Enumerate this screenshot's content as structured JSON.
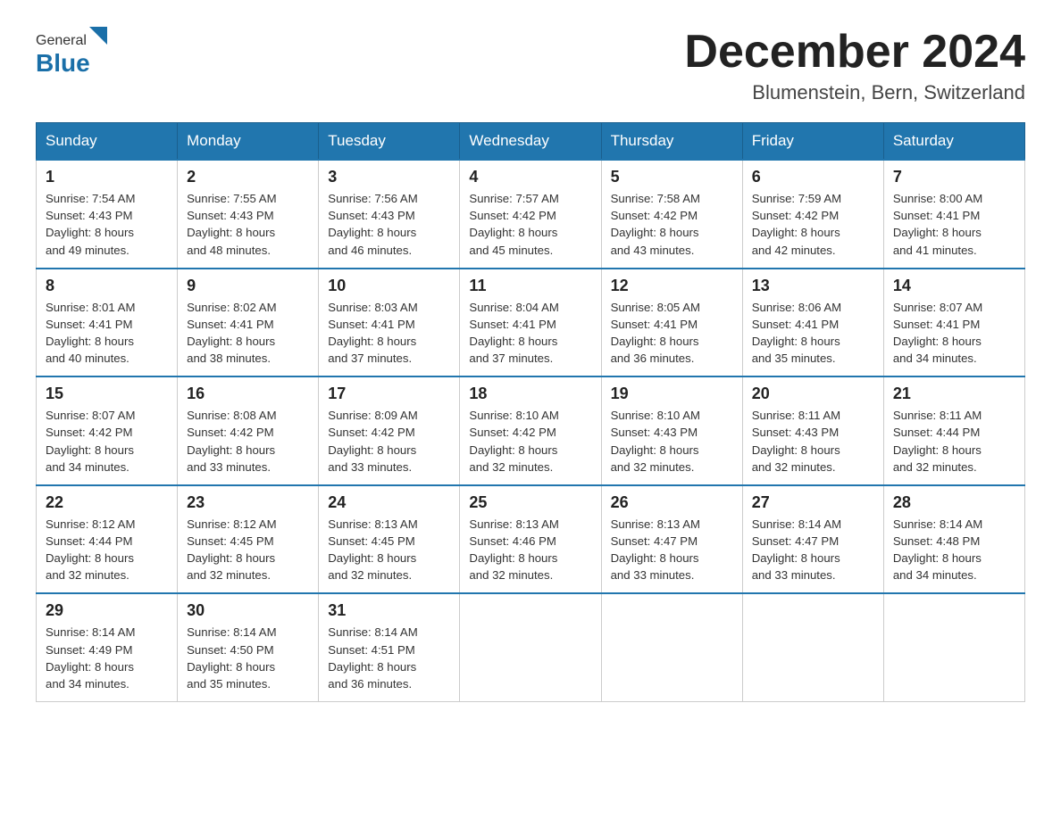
{
  "header": {
    "logo_general": "General",
    "logo_blue": "Blue",
    "month_title": "December 2024",
    "location": "Blumenstein, Bern, Switzerland"
  },
  "days_of_week": [
    "Sunday",
    "Monday",
    "Tuesday",
    "Wednesday",
    "Thursday",
    "Friday",
    "Saturday"
  ],
  "weeks": [
    [
      {
        "day": "1",
        "sunrise": "7:54 AM",
        "sunset": "4:43 PM",
        "daylight": "8 hours and 49 minutes."
      },
      {
        "day": "2",
        "sunrise": "7:55 AM",
        "sunset": "4:43 PM",
        "daylight": "8 hours and 48 minutes."
      },
      {
        "day": "3",
        "sunrise": "7:56 AM",
        "sunset": "4:43 PM",
        "daylight": "8 hours and 46 minutes."
      },
      {
        "day": "4",
        "sunrise": "7:57 AM",
        "sunset": "4:42 PM",
        "daylight": "8 hours and 45 minutes."
      },
      {
        "day": "5",
        "sunrise": "7:58 AM",
        "sunset": "4:42 PM",
        "daylight": "8 hours and 43 minutes."
      },
      {
        "day": "6",
        "sunrise": "7:59 AM",
        "sunset": "4:42 PM",
        "daylight": "8 hours and 42 minutes."
      },
      {
        "day": "7",
        "sunrise": "8:00 AM",
        "sunset": "4:41 PM",
        "daylight": "8 hours and 41 minutes."
      }
    ],
    [
      {
        "day": "8",
        "sunrise": "8:01 AM",
        "sunset": "4:41 PM",
        "daylight": "8 hours and 40 minutes."
      },
      {
        "day": "9",
        "sunrise": "8:02 AM",
        "sunset": "4:41 PM",
        "daylight": "8 hours and 38 minutes."
      },
      {
        "day": "10",
        "sunrise": "8:03 AM",
        "sunset": "4:41 PM",
        "daylight": "8 hours and 37 minutes."
      },
      {
        "day": "11",
        "sunrise": "8:04 AM",
        "sunset": "4:41 PM",
        "daylight": "8 hours and 37 minutes."
      },
      {
        "day": "12",
        "sunrise": "8:05 AM",
        "sunset": "4:41 PM",
        "daylight": "8 hours and 36 minutes."
      },
      {
        "day": "13",
        "sunrise": "8:06 AM",
        "sunset": "4:41 PM",
        "daylight": "8 hours and 35 minutes."
      },
      {
        "day": "14",
        "sunrise": "8:07 AM",
        "sunset": "4:41 PM",
        "daylight": "8 hours and 34 minutes."
      }
    ],
    [
      {
        "day": "15",
        "sunrise": "8:07 AM",
        "sunset": "4:42 PM",
        "daylight": "8 hours and 34 minutes."
      },
      {
        "day": "16",
        "sunrise": "8:08 AM",
        "sunset": "4:42 PM",
        "daylight": "8 hours and 33 minutes."
      },
      {
        "day": "17",
        "sunrise": "8:09 AM",
        "sunset": "4:42 PM",
        "daylight": "8 hours and 33 minutes."
      },
      {
        "day": "18",
        "sunrise": "8:10 AM",
        "sunset": "4:42 PM",
        "daylight": "8 hours and 32 minutes."
      },
      {
        "day": "19",
        "sunrise": "8:10 AM",
        "sunset": "4:43 PM",
        "daylight": "8 hours and 32 minutes."
      },
      {
        "day": "20",
        "sunrise": "8:11 AM",
        "sunset": "4:43 PM",
        "daylight": "8 hours and 32 minutes."
      },
      {
        "day": "21",
        "sunrise": "8:11 AM",
        "sunset": "4:44 PM",
        "daylight": "8 hours and 32 minutes."
      }
    ],
    [
      {
        "day": "22",
        "sunrise": "8:12 AM",
        "sunset": "4:44 PM",
        "daylight": "8 hours and 32 minutes."
      },
      {
        "day": "23",
        "sunrise": "8:12 AM",
        "sunset": "4:45 PM",
        "daylight": "8 hours and 32 minutes."
      },
      {
        "day": "24",
        "sunrise": "8:13 AM",
        "sunset": "4:45 PM",
        "daylight": "8 hours and 32 minutes."
      },
      {
        "day": "25",
        "sunrise": "8:13 AM",
        "sunset": "4:46 PM",
        "daylight": "8 hours and 32 minutes."
      },
      {
        "day": "26",
        "sunrise": "8:13 AM",
        "sunset": "4:47 PM",
        "daylight": "8 hours and 33 minutes."
      },
      {
        "day": "27",
        "sunrise": "8:14 AM",
        "sunset": "4:47 PM",
        "daylight": "8 hours and 33 minutes."
      },
      {
        "day": "28",
        "sunrise": "8:14 AM",
        "sunset": "4:48 PM",
        "daylight": "8 hours and 34 minutes."
      }
    ],
    [
      {
        "day": "29",
        "sunrise": "8:14 AM",
        "sunset": "4:49 PM",
        "daylight": "8 hours and 34 minutes."
      },
      {
        "day": "30",
        "sunrise": "8:14 AM",
        "sunset": "4:50 PM",
        "daylight": "8 hours and 35 minutes."
      },
      {
        "day": "31",
        "sunrise": "8:14 AM",
        "sunset": "4:51 PM",
        "daylight": "8 hours and 36 minutes."
      },
      null,
      null,
      null,
      null
    ]
  ],
  "labels": {
    "sunrise": "Sunrise:",
    "sunset": "Sunset:",
    "daylight": "Daylight:"
  },
  "colors": {
    "header_bg": "#2176ae",
    "header_text": "#ffffff",
    "border_top": "#2176ae"
  }
}
